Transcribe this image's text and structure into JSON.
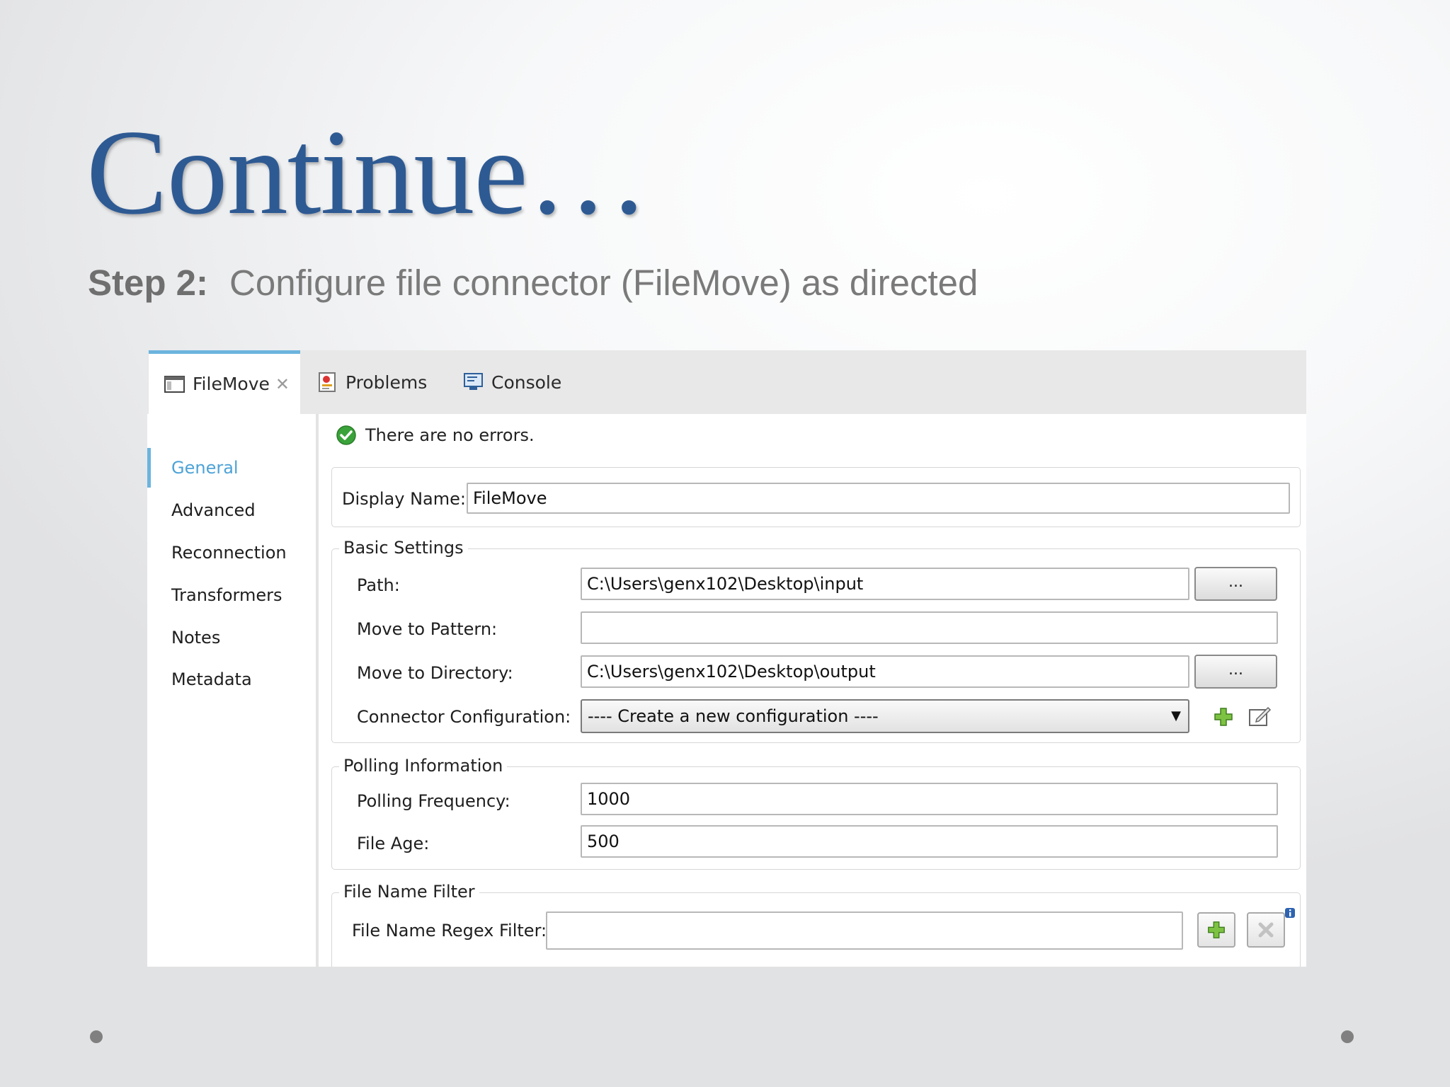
{
  "slide": {
    "title": "Continue…",
    "subtitle_step": "Step 2:",
    "subtitle_text": "Configure file connector (FileMove) as directed"
  },
  "tabs": [
    {
      "label": "FileMove",
      "icon": "window-icon",
      "active": true,
      "closable": true
    },
    {
      "label": "Problems",
      "icon": "problems-icon"
    },
    {
      "label": "Console",
      "icon": "console-icon"
    }
  ],
  "sidebar": {
    "items": [
      {
        "label": "General",
        "active": true
      },
      {
        "label": "Advanced"
      },
      {
        "label": "Reconnection"
      },
      {
        "label": "Transformers"
      },
      {
        "label": "Notes"
      },
      {
        "label": "Metadata"
      }
    ]
  },
  "status": {
    "message": "There are no errors.",
    "icon": "success-check-icon"
  },
  "form": {
    "display_name": {
      "label": "Display Name:",
      "value": "FileMove"
    },
    "basic_settings": {
      "legend": "Basic Settings",
      "path": {
        "label": "Path:",
        "value": "C:\\Users\\genx102\\Desktop\\input",
        "browse_label": "..."
      },
      "move_to_pattern": {
        "label": "Move to Pattern:",
        "value": ""
      },
      "move_to_directory": {
        "label": "Move to Directory:",
        "value": "C:\\Users\\genx102\\Desktop\\output",
        "browse_label": "..."
      },
      "connector_configuration": {
        "label": "Connector Configuration:",
        "value": "---- Create a new configuration ----"
      }
    },
    "polling_information": {
      "legend": "Polling Information",
      "polling_frequency": {
        "label": "Polling Frequency:",
        "value": "1000"
      },
      "file_age": {
        "label": "File Age:",
        "value": "500"
      }
    },
    "file_name_filter": {
      "legend": "File Name Filter",
      "regex_filter": {
        "label": "File Name Regex Filter:",
        "value": ""
      }
    }
  },
  "colors": {
    "title": "#2e5a93",
    "active_tab": "#6bb4de",
    "active_sidebar": "#4ea3d7",
    "success": "#3aa33a"
  }
}
